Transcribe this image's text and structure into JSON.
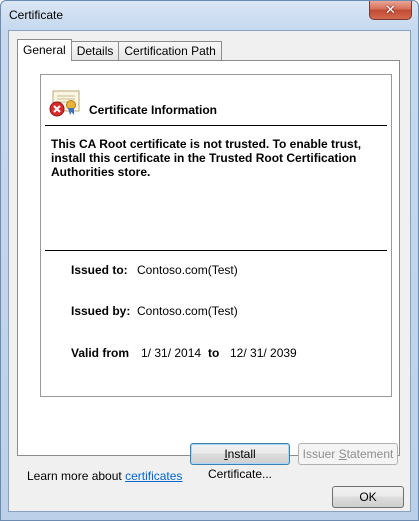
{
  "window": {
    "title": "Certificate",
    "close_glyph": "✕"
  },
  "tabs": [
    {
      "label": "General",
      "active": true
    },
    {
      "label": "Details",
      "active": false
    },
    {
      "label": "Certification Path",
      "active": false
    }
  ],
  "info": {
    "icon": "certificate-error-icon",
    "header": "Certificate Information",
    "warning": "This CA Root certificate is not trusted. To enable trust, install this certificate in the Trusted Root Certification Authorities store."
  },
  "details": {
    "issued_to_label": "Issued to:",
    "issued_to_value": "Contoso.com(Test)",
    "issued_by_label": "Issued by:",
    "issued_by_value": "Contoso.com(Test)",
    "valid_from_label": "Valid from",
    "valid_from_value": "1/ 31/ 2014",
    "valid_to_label": "to",
    "valid_to_value": "12/ 31/ 2039"
  },
  "buttons": {
    "install_prefix": "",
    "install_accel": "I",
    "install_rest": "nstall Certificate...",
    "issuer_prefix": "Issuer ",
    "issuer_accel": "S",
    "issuer_rest": "tatement",
    "ok": "OK"
  },
  "learn_more": {
    "text": "Learn more about ",
    "link": "certificates"
  },
  "colors": {
    "link": "#0066cc",
    "close_button": "#c14a35"
  }
}
